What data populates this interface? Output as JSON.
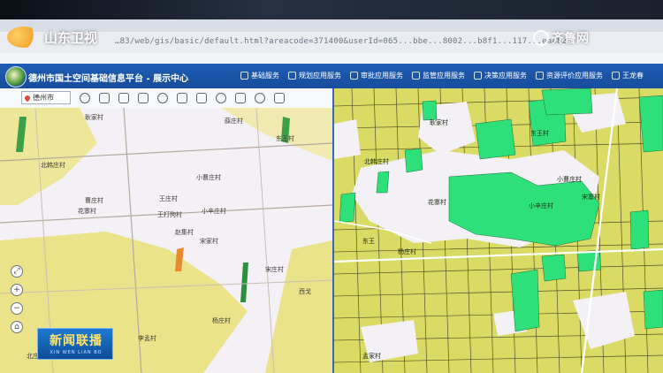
{
  "broadcast": {
    "left_logo_text": "山东卫视",
    "right_logo_text": "齐鲁网",
    "news_badge_title": "新闻联播",
    "news_badge_subtitle": "XIN WEN LIAN BO"
  },
  "browser": {
    "url": "…83/web/gis/basic/default.html?areacode=371400&userId=065...bbe...8002...b8f1...117...ea4828"
  },
  "app": {
    "title": "德州市国土空间基础信息平台 - 展示中心",
    "menu": [
      {
        "label": "基础服务",
        "icon": "grid-icon"
      },
      {
        "label": "规划应用服务",
        "icon": "map-icon"
      },
      {
        "label": "审批应用服务",
        "icon": "doc-icon"
      },
      {
        "label": "监管应用服务",
        "icon": "eye-icon"
      },
      {
        "label": "决策应用服务",
        "icon": "chart-icon"
      },
      {
        "label": "资源评价应用服务",
        "icon": "layers-icon"
      },
      {
        "label": "王龙春",
        "icon": "user-icon"
      }
    ]
  },
  "toolbar": {
    "location_label": "德州市"
  },
  "map_left": {
    "labels": [
      "耿家村",
      "薛庄村",
      "北韩庄村",
      "曹庄村",
      "东王村",
      "小曹庄村",
      "王庄村",
      "王打狗村",
      "小辛庄村",
      "花寨村",
      "宋家村",
      "赵集村",
      "杨庄村",
      "西戈",
      "李孟村",
      "北庄",
      "宋庄村"
    ]
  },
  "map_right": {
    "labels": [
      "耿家村",
      "北韩庄村",
      "东王村",
      "小曹庄村",
      "花寨村",
      "小辛庄村",
      "宋寨村",
      "东王",
      "杨庄村",
      "孟家村"
    ]
  },
  "colors": {
    "header": "#1f5db4",
    "divider": "#3a63c9",
    "land_yellow": "#d9db64",
    "green_parcel": "#2ee07a",
    "village": "#f3f0f6"
  }
}
